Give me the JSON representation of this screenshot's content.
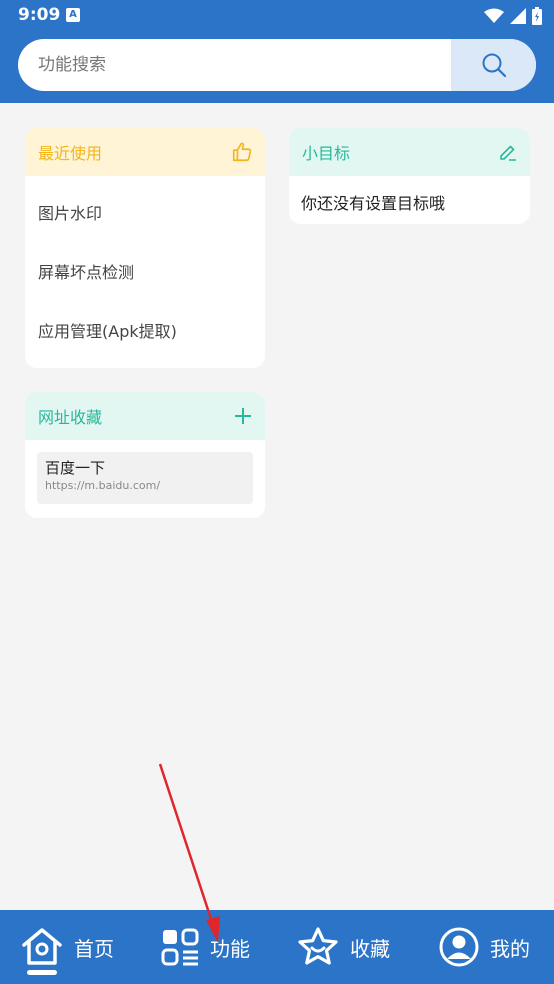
{
  "status_bar": {
    "time": "9:09",
    "a_icon": "A"
  },
  "search": {
    "placeholder": "功能搜索",
    "value": ""
  },
  "recent": {
    "title": "最近使用",
    "items": [
      "图片水印",
      "屏幕坏点检测",
      "应用管理(Apk提取)"
    ]
  },
  "goal": {
    "title": "小目标",
    "empty_text": "你还没有设置目标哦"
  },
  "bookmarks": {
    "title": "网址收藏",
    "items": [
      {
        "title": "百度一下",
        "url": "https://m.baidu.com/"
      }
    ]
  },
  "nav": {
    "home": "首页",
    "functions": "功能",
    "favorites": "收藏",
    "mine": "我的"
  },
  "colors": {
    "primary": "#2b74c8",
    "recent_accent": "#f2b51c",
    "teal_accent": "#27b89a",
    "annotation_arrow": "#e0262b"
  }
}
